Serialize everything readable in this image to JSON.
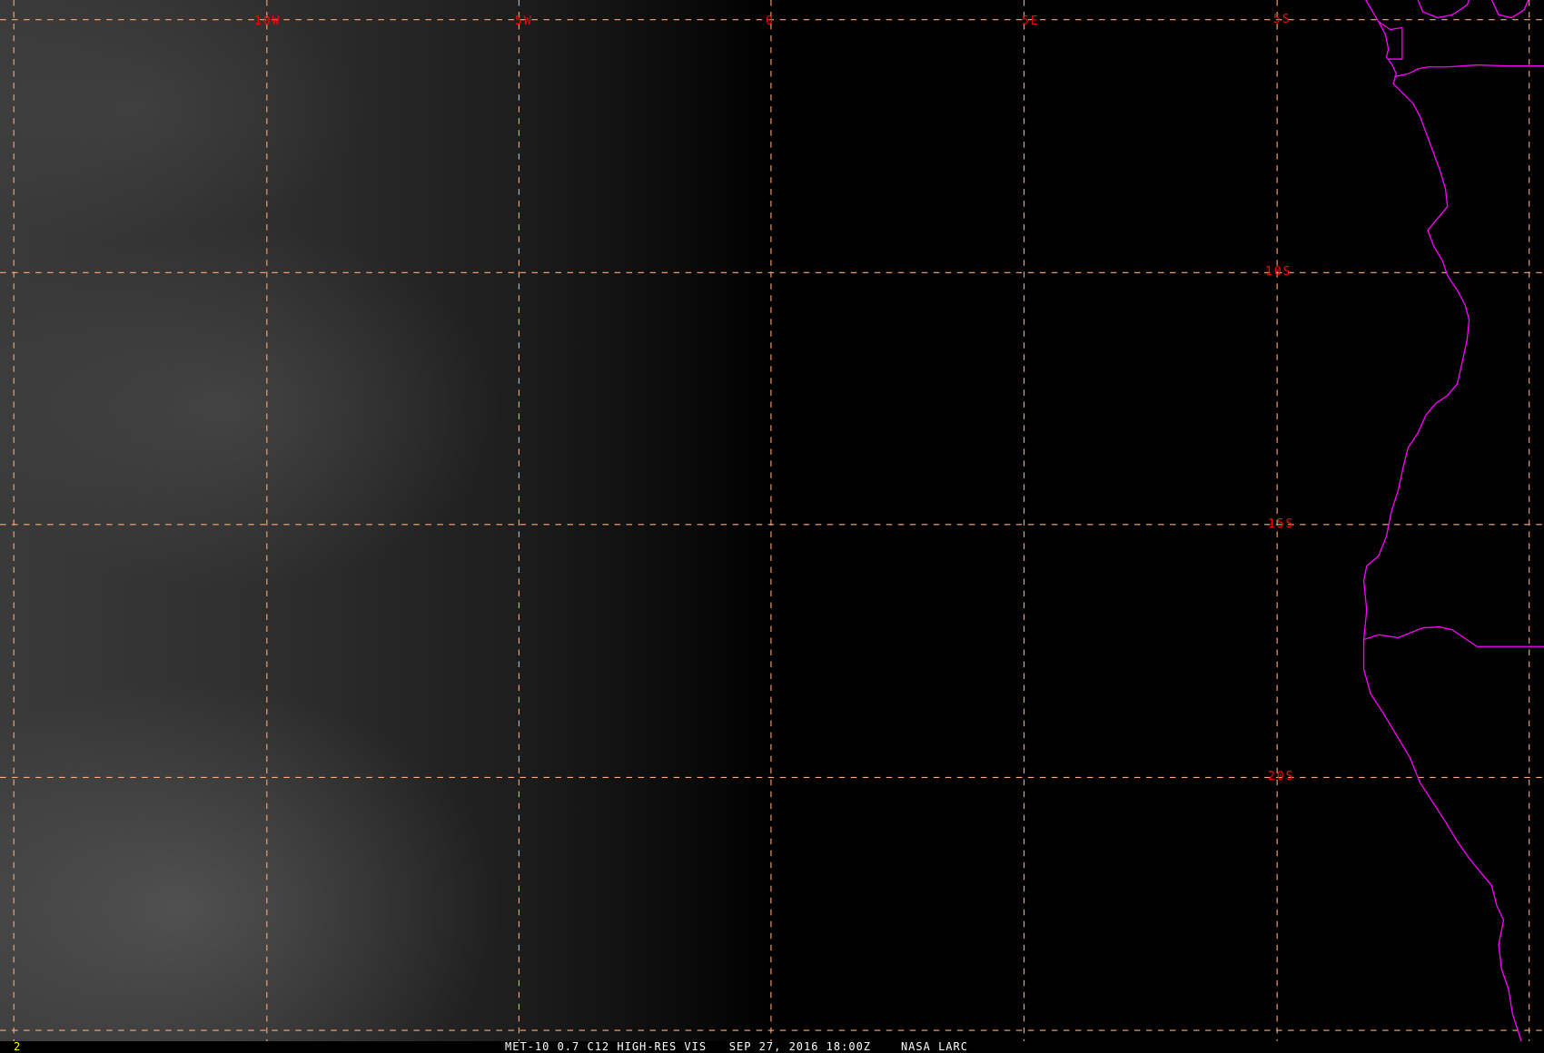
{
  "map": {
    "lon_labels": [
      "10W",
      "5W",
      "0",
      "5E"
    ],
    "lat_labels": [
      "5S",
      "10S",
      "15S",
      "20S"
    ],
    "colors": {
      "grid": "#ffaa77",
      "labels": "#ff0000",
      "coast": "#ff00ff"
    }
  },
  "footer": {
    "frame_number": "2",
    "satellite_product": "MET-10 0.7 C12 HIGH-RES VIS",
    "datetime": "SEP 27, 2016 18:00Z",
    "source": "NASA LARC"
  }
}
